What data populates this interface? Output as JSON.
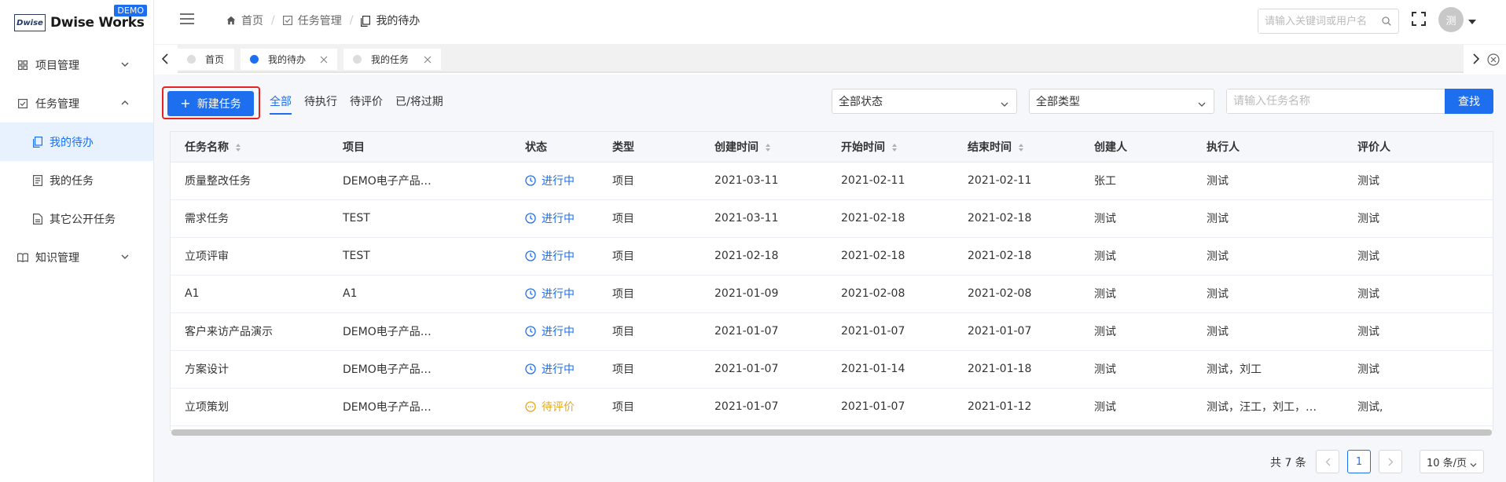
{
  "app": {
    "logo_mark": "Dwise",
    "name": "Dwise Works",
    "badge": "DEMO"
  },
  "sidebar": {
    "items": [
      {
        "label": "项目管理",
        "icon": "grid-icon",
        "expanded": false
      },
      {
        "label": "任务管理",
        "icon": "checkbox-icon",
        "expanded": true
      },
      {
        "label": "知识管理",
        "icon": "book-icon",
        "expanded": false
      }
    ],
    "subitems": [
      {
        "label": "我的待办",
        "active": true
      },
      {
        "label": "我的任务",
        "active": false
      },
      {
        "label": "其它公开任务",
        "active": false
      }
    ]
  },
  "header": {
    "breadcrumb": [
      "首页",
      "任务管理",
      "我的待办"
    ],
    "search_placeholder": "请输入关键词或用户名",
    "avatar_text": "测"
  },
  "tabs": [
    {
      "label": "首页",
      "active": false,
      "closable": false
    },
    {
      "label": "我的待办",
      "active": true,
      "closable": true
    },
    {
      "label": "我的任务",
      "active": false,
      "closable": true
    }
  ],
  "toolbar": {
    "new_task": "新建任务",
    "filters": [
      "全部",
      "待执行",
      "待评价",
      "已/将过期"
    ],
    "active_filter": "全部",
    "status_select": "全部状态",
    "type_select": "全部类型",
    "task_search_placeholder": "请输入任务名称",
    "search_button": "查找"
  },
  "table": {
    "columns": [
      "任务名称",
      "项目",
      "状态",
      "类型",
      "创建时间",
      "开始时间",
      "结束时间",
      "创建人",
      "执行人",
      "评价人"
    ],
    "rows": [
      {
        "name": "质量整改任务",
        "project": "DEMO电子产品科技有限公司",
        "status": "进行中",
        "status_kind": "running",
        "type": "项目",
        "created": "2021-03-11",
        "start": "2021-02-11",
        "end": "2021-02-11",
        "creator": "张工",
        "executor": "测试",
        "reviewer": "测试"
      },
      {
        "name": "需求任务",
        "project": "TEST",
        "status": "进行中",
        "status_kind": "running",
        "type": "项目",
        "created": "2021-03-11",
        "start": "2021-02-18",
        "end": "2021-02-18",
        "creator": "测试",
        "executor": "测试",
        "reviewer": "测试"
      },
      {
        "name": "立项评审",
        "project": "TEST",
        "status": "进行中",
        "status_kind": "running",
        "type": "项目",
        "created": "2021-02-18",
        "start": "2021-02-18",
        "end": "2021-02-18",
        "creator": "测试",
        "executor": "测试",
        "reviewer": "测试"
      },
      {
        "name": "A1",
        "project": "A1",
        "status": "进行中",
        "status_kind": "running",
        "type": "项目",
        "created": "2021-01-09",
        "start": "2021-02-08",
        "end": "2021-02-08",
        "creator": "测试",
        "executor": "测试",
        "reviewer": "测试"
      },
      {
        "name": "客户来访产品演示",
        "project": "DEMO电子产品科技有限公司",
        "status": "进行中",
        "status_kind": "running",
        "type": "项目",
        "created": "2021-01-07",
        "start": "2021-01-07",
        "end": "2021-01-07",
        "creator": "测试",
        "executor": "测试",
        "reviewer": "测试"
      },
      {
        "name": "方案设计",
        "project": "DEMO电子产品科技有限公司",
        "status": "进行中",
        "status_kind": "running",
        "type": "项目",
        "created": "2021-01-07",
        "start": "2021-01-14",
        "end": "2021-01-18",
        "creator": "测试",
        "executor": "测试，刘工",
        "reviewer": "测试"
      },
      {
        "name": "立项策划",
        "project": "DEMO电子产品科技有限公司",
        "status": "待评价",
        "status_kind": "pending",
        "type": "项目",
        "created": "2021-01-07",
        "start": "2021-01-07",
        "end": "2021-01-12",
        "creator": "测试",
        "executor": "测试，汪工，刘工，李工",
        "reviewer": "测试,"
      }
    ]
  },
  "pagination": {
    "total": "共 7 条",
    "current_page": "1",
    "page_size": "10 条/页"
  },
  "colors": {
    "primary": "#1e6ff0",
    "pending": "#e6a817",
    "highlight_outline": "#e62222"
  }
}
